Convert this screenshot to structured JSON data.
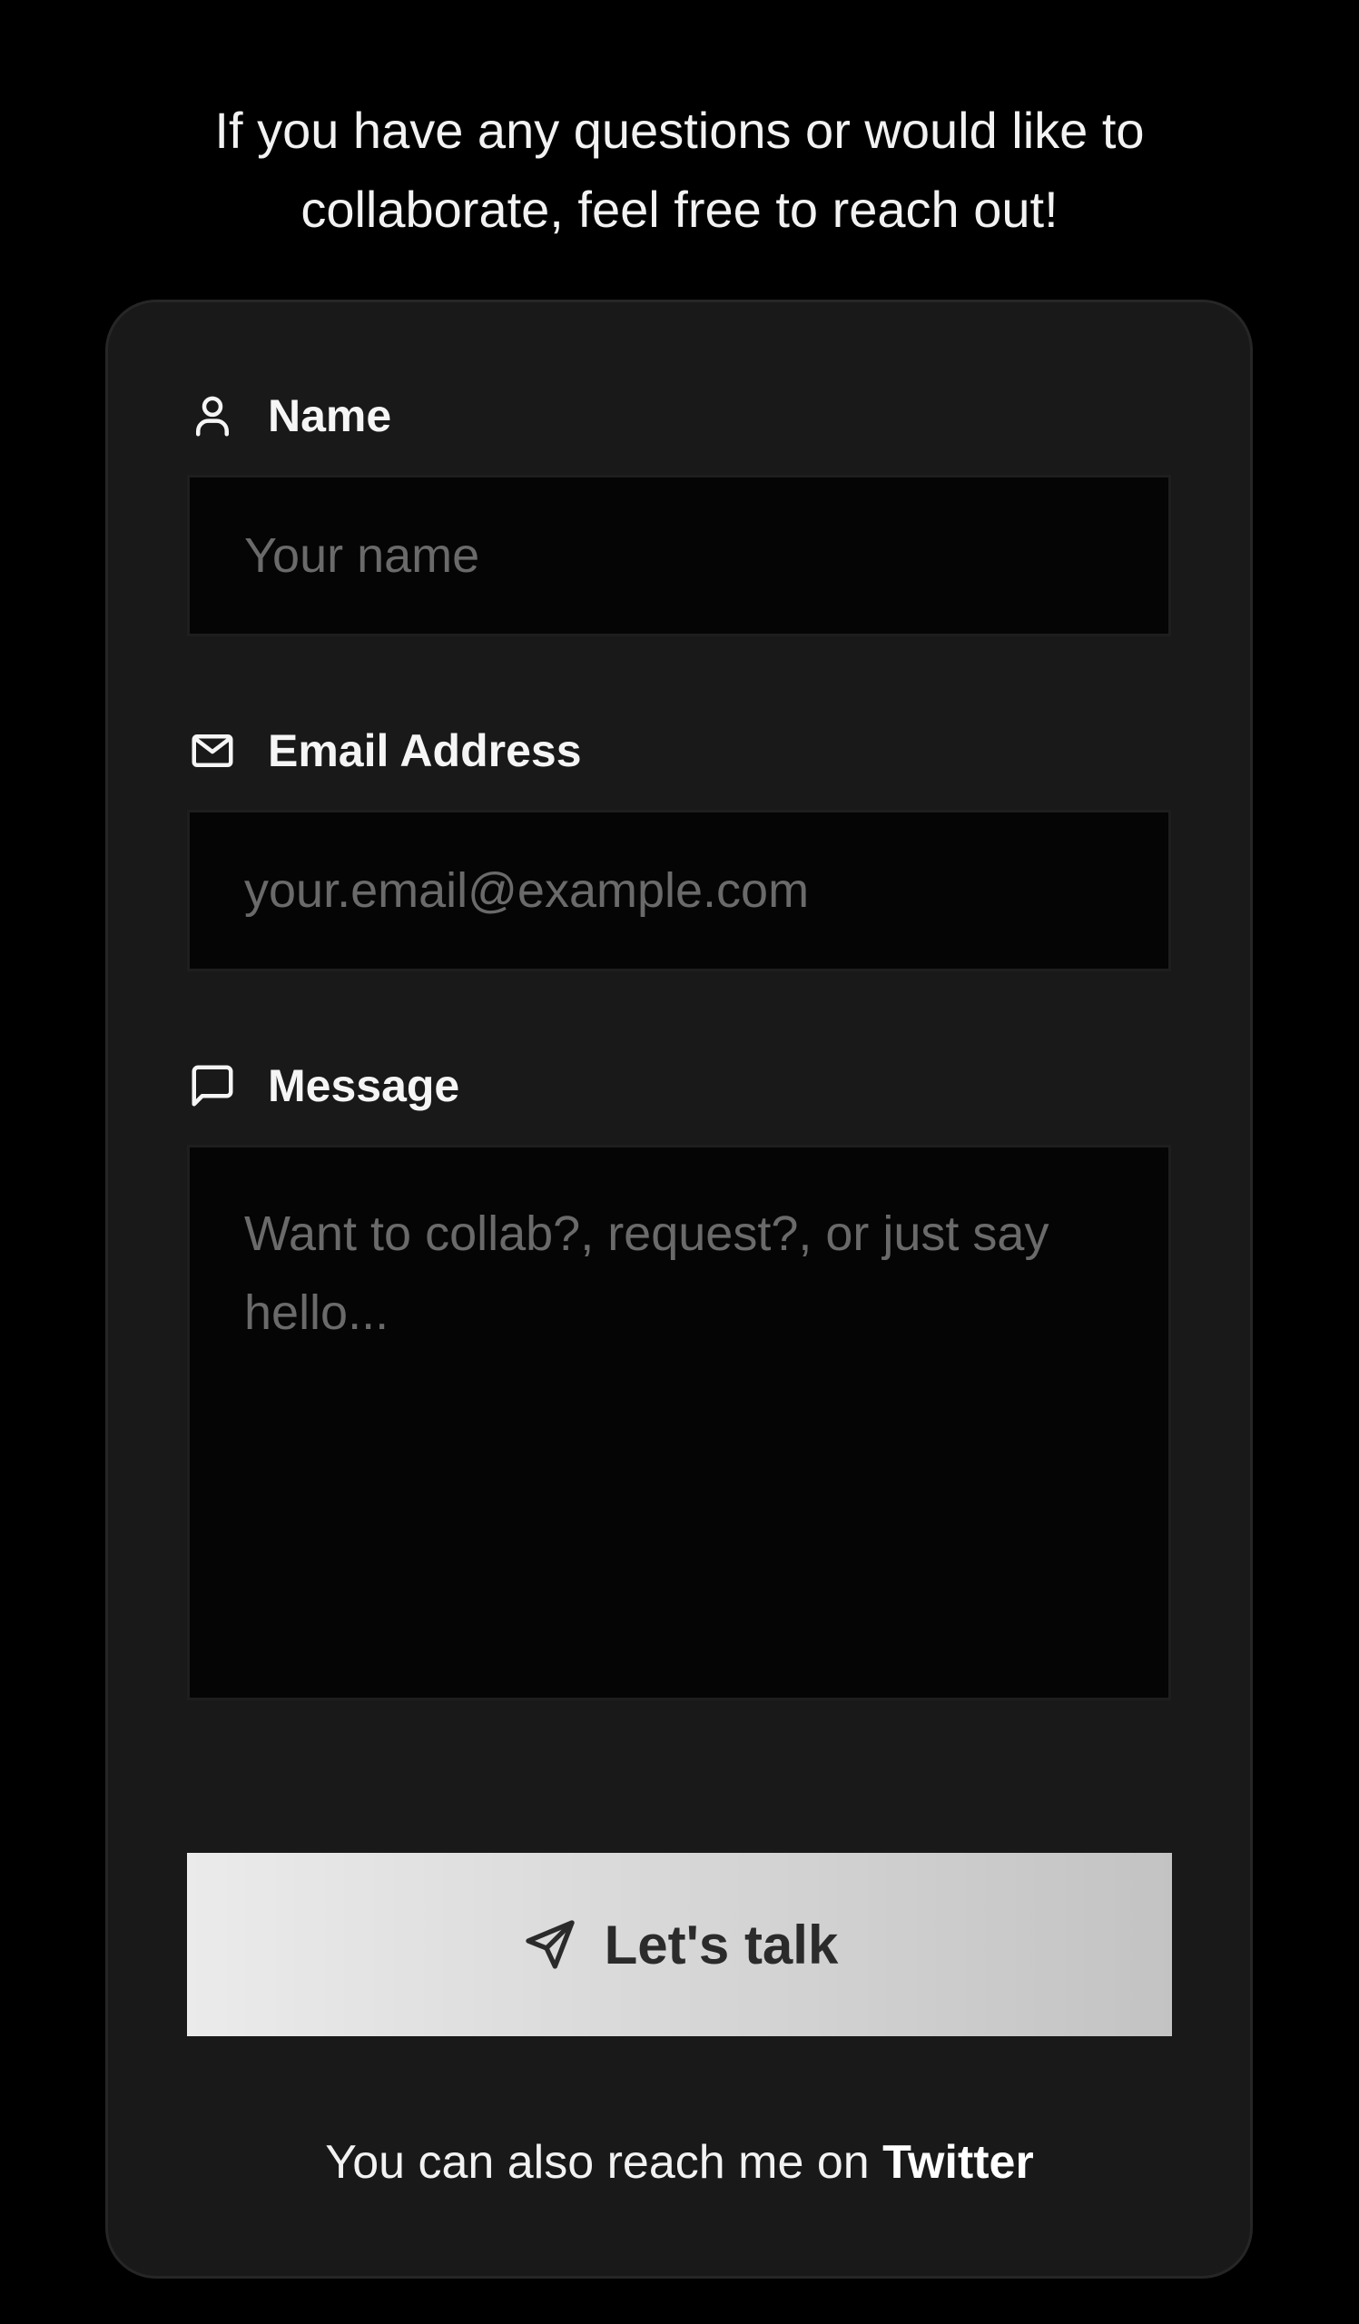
{
  "intro": {
    "line1": "If you have any questions or would like to",
    "line2": "collaborate, feel free to reach out!"
  },
  "form": {
    "name": {
      "label": "Name",
      "icon": "user-icon",
      "placeholder": "Your name",
      "value": ""
    },
    "email": {
      "label": "Email Address",
      "icon": "mail-icon",
      "placeholder": "your.email@example.com",
      "value": ""
    },
    "message": {
      "label": "Message",
      "icon": "message-square-icon",
      "placeholder": "Want to collab?, request?, or just say hello...",
      "value": ""
    },
    "submit": {
      "label": "Let's talk",
      "icon": "send-icon"
    }
  },
  "footer": {
    "text": "You can also reach me on ",
    "link_label": "Twitter"
  },
  "colors": {
    "background": "#000000",
    "card": "#191919",
    "input": "#050505",
    "button_gradient_start": "#ebebeb",
    "button_gradient_end": "#c3c3c3"
  }
}
